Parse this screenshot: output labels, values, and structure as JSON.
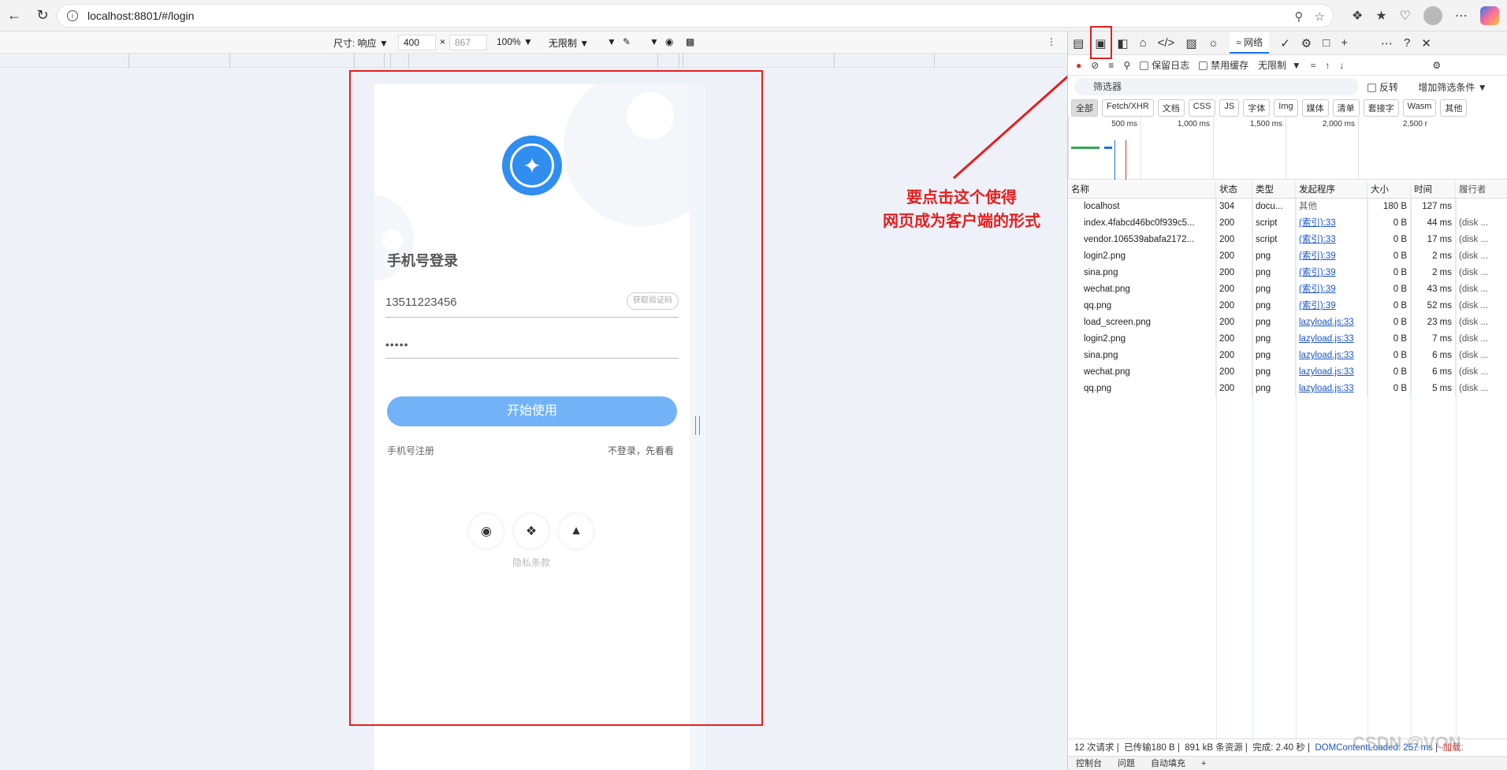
{
  "browser": {
    "url": "localhost:8801/#/login"
  },
  "device_toolbar": {
    "dimension_label": "尺寸: 响应",
    "width": "400",
    "times": "×",
    "height": "867",
    "zoom": "100%",
    "throttle": "无限制"
  },
  "app": {
    "title": "手机号登录",
    "phone_value": "13511223456",
    "code_button": "获取验证码",
    "password_value": "•••••",
    "start_button": "开始使用",
    "register_link": "手机号注册",
    "guest_link": "不登录，先看看",
    "privacy": "隐私条款",
    "socials": [
      "weibo-icon",
      "wechat-icon",
      "qq-icon"
    ]
  },
  "annotation": {
    "line1": "要点击这个使得",
    "line2": "网页成为客户端的形式"
  },
  "devtools": {
    "active_tab": "网络",
    "preserve_log": "保留日志",
    "disable_cache": "禁用缓存",
    "throttle": "无限制",
    "filter_placeholder": "筛选器",
    "invert": "反转",
    "more_filters": "增加筛选条件",
    "types": [
      "全部",
      "Fetch/XHR",
      "文档",
      "CSS",
      "JS",
      "字体",
      "Img",
      "媒体",
      "清单",
      "套接字",
      "Wasm",
      "其他"
    ],
    "timeline_ticks": [
      "500 ms",
      "1,000 ms",
      "1,500 ms",
      "2,000 ms",
      "2,500 r"
    ],
    "columns": [
      "名称",
      "状态",
      "类型",
      "发起程序",
      "大小",
      "时间",
      "履行者"
    ],
    "rows": [
      {
        "name": "localhost",
        "status": "304",
        "type": "docu...",
        "initiator": "其他",
        "size": "180 B",
        "time": "127 ms",
        "fulfill": ""
      },
      {
        "name": "index.4fabcd46bc0f939c5...",
        "status": "200",
        "type": "script",
        "initiator": "(索引):33",
        "size": "0 B",
        "time": "44 ms",
        "fulfill": "(disk ..."
      },
      {
        "name": "vendor.106539abafa2172...",
        "status": "200",
        "type": "script",
        "initiator": "(索引):33",
        "size": "0 B",
        "time": "17 ms",
        "fulfill": "(disk ..."
      },
      {
        "name": "login2.png",
        "status": "200",
        "type": "png",
        "initiator": "(索引):39",
        "size": "0 B",
        "time": "2 ms",
        "fulfill": "(disk ..."
      },
      {
        "name": "sina.png",
        "status": "200",
        "type": "png",
        "initiator": "(索引):39",
        "size": "0 B",
        "time": "2 ms",
        "fulfill": "(disk ..."
      },
      {
        "name": "wechat.png",
        "status": "200",
        "type": "png",
        "initiator": "(索引):39",
        "size": "0 B",
        "time": "43 ms",
        "fulfill": "(disk ..."
      },
      {
        "name": "qq.png",
        "status": "200",
        "type": "png",
        "initiator": "(索引):39",
        "size": "0 B",
        "time": "52 ms",
        "fulfill": "(disk ..."
      },
      {
        "name": "load_screen.png",
        "status": "200",
        "type": "png",
        "initiator": "lazyload.js:33",
        "size": "0 B",
        "time": "23 ms",
        "fulfill": "(disk ..."
      },
      {
        "name": "login2.png",
        "status": "200",
        "type": "png",
        "initiator": "lazyload.js:33",
        "size": "0 B",
        "time": "7 ms",
        "fulfill": "(disk ..."
      },
      {
        "name": "sina.png",
        "status": "200",
        "type": "png",
        "initiator": "lazyload.js:33",
        "size": "0 B",
        "time": "6 ms",
        "fulfill": "(disk ..."
      },
      {
        "name": "wechat.png",
        "status": "200",
        "type": "png",
        "initiator": "lazyload.js:33",
        "size": "0 B",
        "time": "6 ms",
        "fulfill": "(disk ..."
      },
      {
        "name": "qq.png",
        "status": "200",
        "type": "png",
        "initiator": "lazyload.js:33",
        "size": "0 B",
        "time": "5 ms",
        "fulfill": "(disk ..."
      }
    ],
    "status_bar": {
      "requests": "12 次请求",
      "transferred": "已传输180 B",
      "resources": "891 kB 条资源",
      "finish": "完成: 2.40 秒",
      "dcl": "DOMContentLoaded: 257 ms",
      "load": "加载:"
    },
    "bottom_tabs": [
      "控制台",
      "问题",
      "自动填充"
    ]
  },
  "watermark": "CSDN @VON",
  "colors": {
    "accent": "#2f8ef0",
    "button": "#72b3f8",
    "annotation": "#e41f1f"
  }
}
